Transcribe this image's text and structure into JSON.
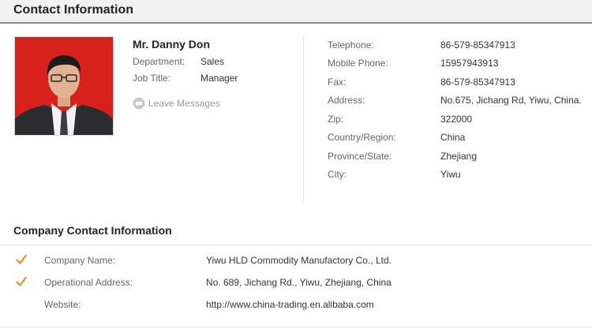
{
  "header": {
    "title": "Contact Information"
  },
  "person": {
    "name": "Mr. Danny Don",
    "department_label": "Department:",
    "department": "Sales",
    "job_title_label": "Job Title:",
    "job_title": "Manager",
    "leave_messages": "Leave Messages",
    "photo_icon": "person-photo"
  },
  "details": [
    {
      "label": "Telephone:",
      "value": "86-579-85347913"
    },
    {
      "label": "Mobile Phone:",
      "value": "15957943913"
    },
    {
      "label": "Fax:",
      "value": "86-579-85347913"
    },
    {
      "label": "Address:",
      "value": "No.675, Jichang Rd, Yiwu, China."
    },
    {
      "label": "Zip:",
      "value": "322000"
    },
    {
      "label": "Country/Region:",
      "value": "China"
    },
    {
      "label": "Province/State:",
      "value": "Zhejiang"
    },
    {
      "label": "City:",
      "value": "Yiwu"
    }
  ],
  "company": {
    "title": "Company Contact Information",
    "rows": [
      {
        "label": "Company Name:",
        "value": "Yiwu HLD Commodity Manufactory Co., Ltd.",
        "verified": true
      },
      {
        "label": "Operational Address:",
        "value": "No. 689, Jichang Rd., Yiwu, Zhejiang, China",
        "verified": true
      },
      {
        "label": "Website:",
        "value": "http://www.china-trading.en.alibaba.com",
        "verified": false
      }
    ]
  },
  "colors": {
    "accent_check": "#f08c1c",
    "photo_background": "#d9211b"
  }
}
